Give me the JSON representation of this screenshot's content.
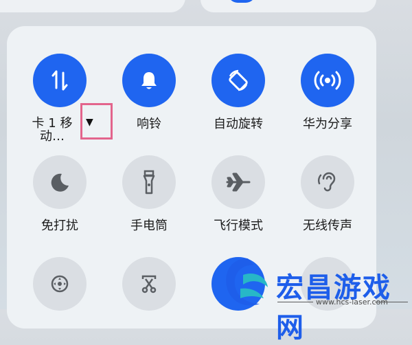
{
  "tiles": {
    "mobile_data": {
      "label_line1": "卡 1 移",
      "label_line2": "动…",
      "arrow": "▼",
      "icon": "data-transfer-icon",
      "state": "on"
    },
    "ring": {
      "label": "响铃",
      "icon": "bell-icon",
      "state": "on"
    },
    "auto_rotate": {
      "label": "自动旋转",
      "icon": "rotate-icon",
      "state": "on"
    },
    "huawei_share": {
      "label": "华为分享",
      "icon": "broadcast-icon",
      "state": "on"
    },
    "do_not_disturb": {
      "label": "免打扰",
      "icon": "moon-icon",
      "state": "off"
    },
    "flashlight": {
      "label": "手电筒",
      "icon": "flashlight-icon",
      "state": "off"
    },
    "airplane_mode": {
      "label": "飞行模式",
      "icon": "airplane-icon",
      "state": "off"
    },
    "wireless_audio": {
      "label": "无线传声",
      "icon": "ear-icon",
      "state": "off"
    }
  },
  "watermark": {
    "title": "宏昌游戏网",
    "url": "www.hcs-laser.com"
  },
  "colors": {
    "accent": "#1f65f0",
    "tile_off": "#dadee3",
    "highlight": "#e3648c"
  }
}
